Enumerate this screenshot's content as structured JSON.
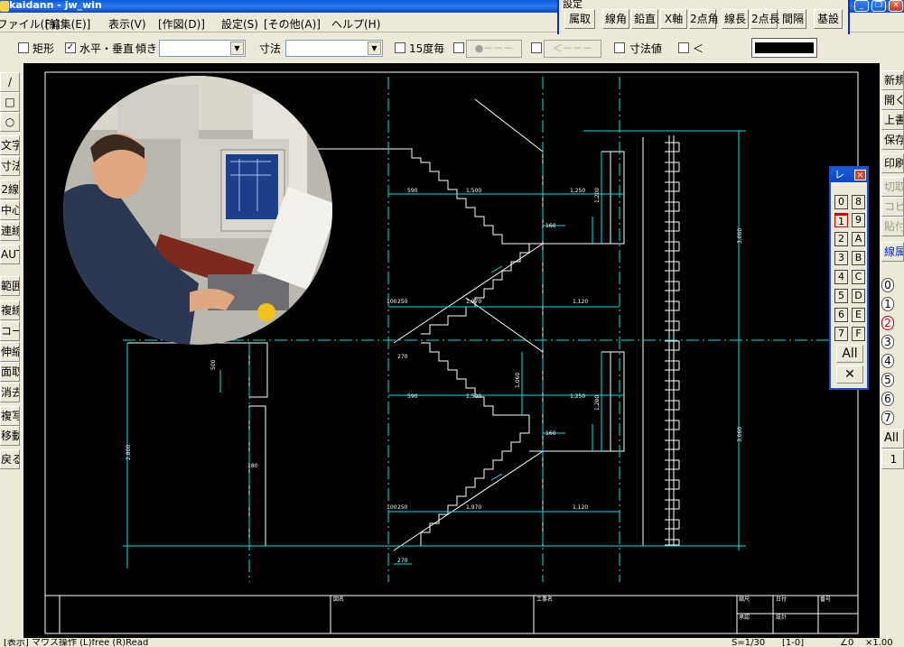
{
  "window": {
    "title": "kaidann - jw_win"
  },
  "menu": [
    "[ファイル(F)]",
    "[編集(E)]",
    "表示(V)",
    "[作図(D)]",
    "設定(S)",
    "[その他(A)]",
    "ヘルプ(H)"
  ],
  "settings_popup": {
    "title": "設定",
    "buttons": [
      "属取",
      "線角",
      "鉛直",
      "X軸",
      "2点角",
      "線長",
      "2点長",
      "間隔",
      "基設"
    ]
  },
  "options": {
    "rect_label": "矩形",
    "horiz_vert_label": "水平・垂直",
    "tilt_label": "傾き",
    "tilt_value": "",
    "dimension_label": "寸法",
    "dimension_value": "",
    "deg15_label": "15度毎",
    "btn_dot": "●－－－",
    "btn_arrow": "＜－－－",
    "dim_value_label": "寸法値",
    "lt_label": "＜"
  },
  "left_tools": [
    "/",
    "□",
    "○",
    "文字",
    "寸法",
    "2線",
    "中心線",
    "連線",
    "AUTO",
    "範囲",
    "複線",
    "コーナー",
    "伸縮",
    "面取",
    "消去",
    "複写",
    "移動",
    "戻る"
  ],
  "right_tools": {
    "file": [
      "新規",
      "開く",
      "上書",
      "保存",
      "印刷"
    ],
    "edit_disabled": [
      "切取",
      "コピー",
      "貼付"
    ],
    "layer_group": "線属性",
    "layer_numbers": [
      "0",
      "1",
      "2",
      "3",
      "4",
      "5",
      "6",
      "7"
    ],
    "all_label": "All",
    "bottom": "1"
  },
  "layer_palette": {
    "title": "レ",
    "left": [
      "0",
      "1",
      "2",
      "3",
      "4",
      "5",
      "6",
      "7"
    ],
    "right": [
      "8",
      "9",
      "A",
      "B",
      "C",
      "D",
      "E",
      "F"
    ],
    "all_label": "All",
    "x_label": "✕"
  },
  "drawing": {
    "dims": [
      "590",
      "1,500",
      "1,250",
      "1,200",
      "160",
      "100",
      "250",
      "1,970",
      "1,120",
      "270",
      "500",
      "2,800",
      "180",
      "3,000",
      "3,060",
      "1,060",
      "2,800"
    ],
    "title_block": [
      "図名",
      "工事名",
      "縮尺",
      "日付",
      "番号",
      "承認",
      "設計",
      "検図"
    ]
  },
  "status": {
    "text": "[表示] マウス操作 (L)free (R)Read",
    "scale": "S=1/30",
    "layer": "[1-0]",
    "angle": "∠0",
    "zoom": "×1.00"
  }
}
